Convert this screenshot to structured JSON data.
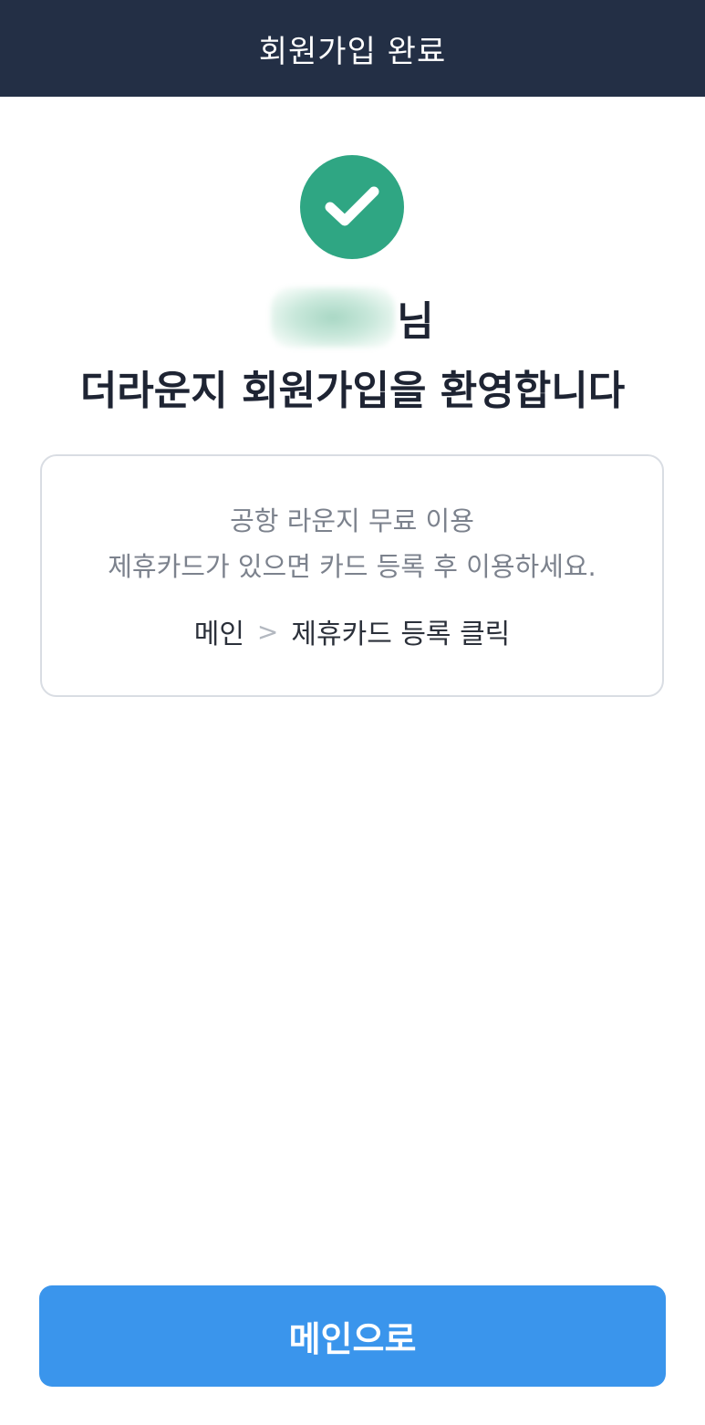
{
  "header": {
    "title": "회원가입 완료"
  },
  "colors": {
    "header_bg": "#232f45",
    "success": "#2fa683",
    "primary": "#3a95ec"
  },
  "icons": {
    "status": "check-icon"
  },
  "welcome": {
    "name_suffix": "님",
    "message": "더라운지 회원가입을 환영합니다"
  },
  "info_box": {
    "line1": "공항 라운지 무료 이용",
    "line2": "제휴카드가 있으면 카드 등록 후 이용하세요.",
    "path_from": "메인",
    "path_separator": ">",
    "path_to": "제휴카드 등록 클릭"
  },
  "footer": {
    "button_label": "메인으로"
  }
}
